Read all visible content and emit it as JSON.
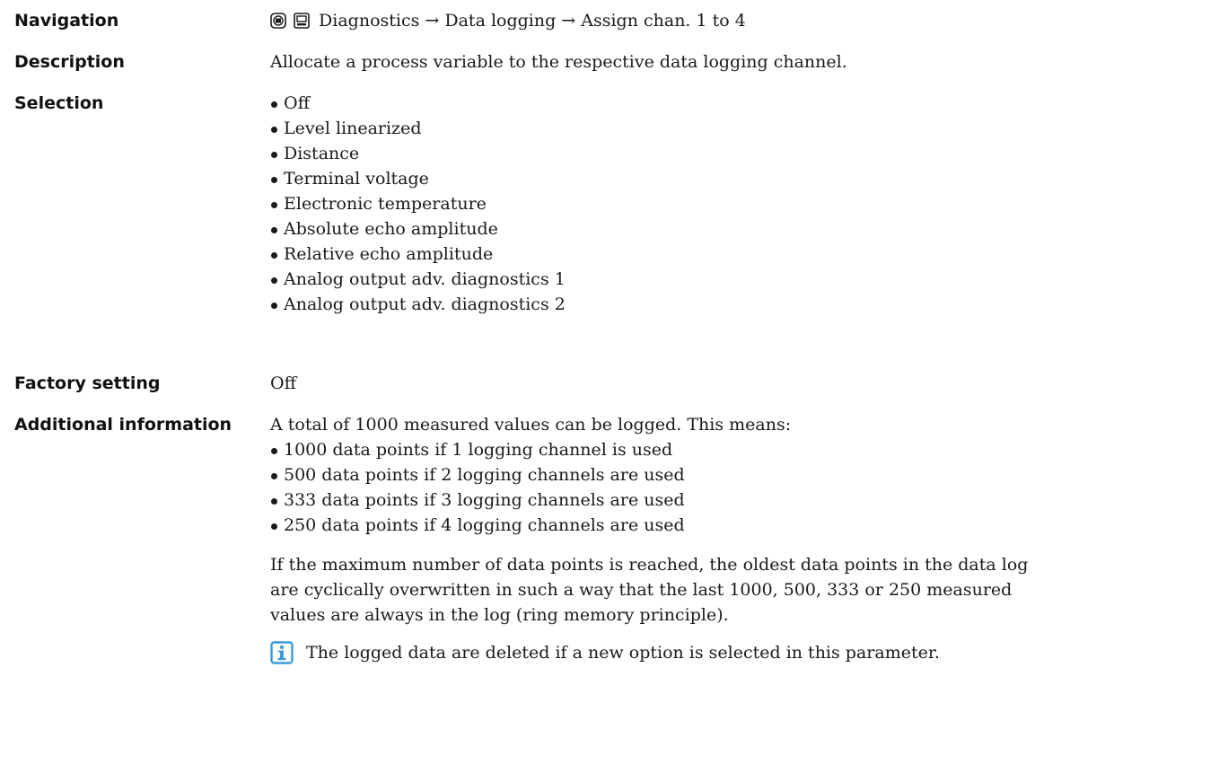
{
  "navigation": {
    "label": "Navigation",
    "path": "Diagnostics → Data logging → Assign chan. 1 to 4"
  },
  "description": {
    "label": "Description",
    "text": "Allocate a process variable to the respective data logging channel."
  },
  "selection": {
    "label": "Selection",
    "options": [
      "Off",
      "Level linearized",
      "Distance",
      "Terminal voltage",
      "Electronic temperature",
      "Absolute echo amplitude",
      "Relative echo amplitude",
      "Analog output adv. diagnostics 1",
      "Analog output adv. diagnostics 2"
    ]
  },
  "factory_setting": {
    "label": "Factory setting",
    "value": "Off"
  },
  "additional_information": {
    "label": "Additional information",
    "intro": "A total of 1000 measured values can be logged. This means:",
    "points": [
      "1000 data points if 1 logging channel is used",
      "500 data points if 2 logging channels are used",
      "333 data points if 3 logging channels are used",
      "250 data points if 4 logging channels are used"
    ],
    "paragraph_lines": [
      "If the maximum number of data points is reached, the oldest data points in the data log",
      "are cyclically overwritten in such a way that the last 1000, 500, 333 or 250 measured",
      "values are always in the log (ring memory principle)."
    ],
    "note": "The logged data are deleted if a new option is selected in this parameter."
  },
  "icons": {
    "navigation": [
      "operating-tool-icon",
      "local-display-icon"
    ],
    "note": "info-icon"
  },
  "colors": {
    "info_icon": "#3a9bd5",
    "text": "#1a1a1a"
  }
}
